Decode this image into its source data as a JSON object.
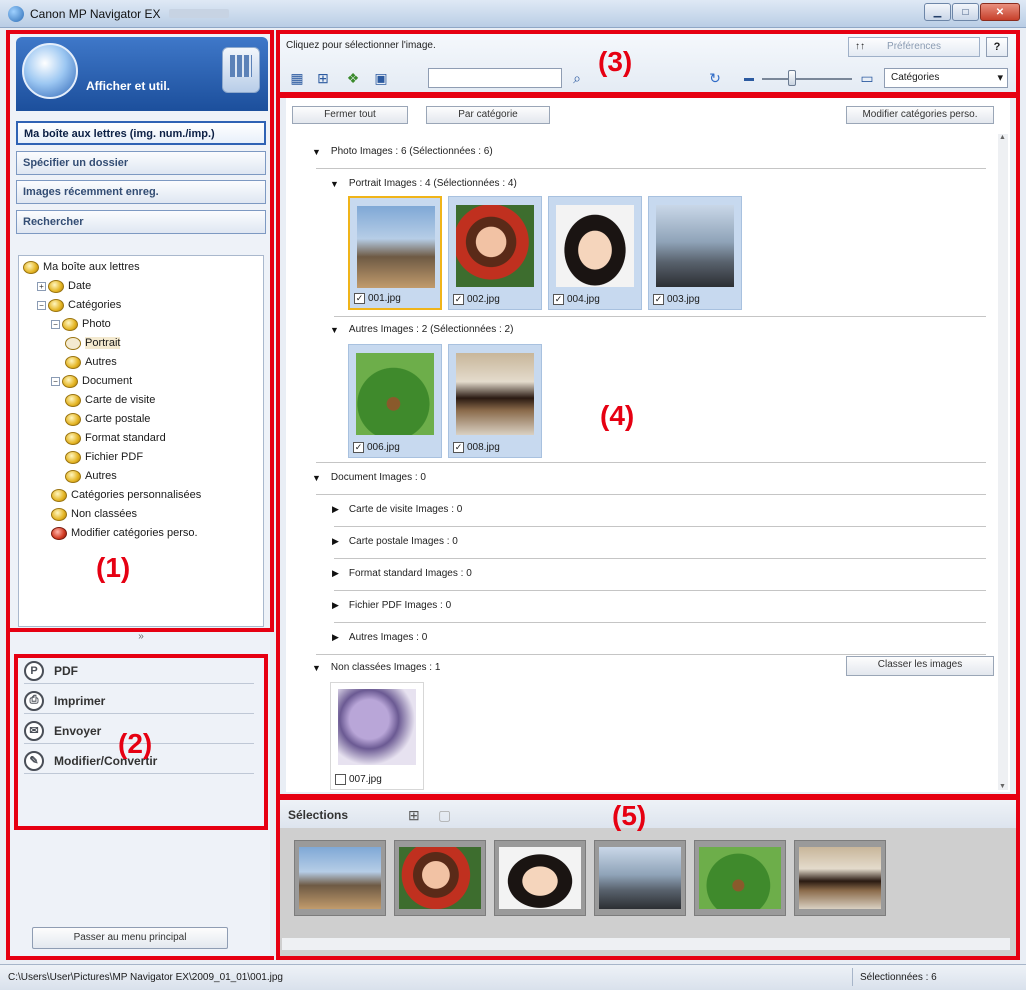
{
  "window": {
    "title": "Canon MP Navigator EX"
  },
  "left_panel": {
    "mode_label": "Afficher et util.",
    "nav_buttons": [
      {
        "label": "Ma boîte aux lettres (img. num./imp.)",
        "active": true
      },
      {
        "label": "Spécifier un dossier",
        "active": false
      },
      {
        "label": "Images récemment enreg.",
        "active": false
      },
      {
        "label": "Rechercher",
        "active": false
      }
    ],
    "tree": [
      {
        "label": "Ma boîte aux lettres",
        "level": 0,
        "toggle": "",
        "color": "yellow"
      },
      {
        "label": "Date",
        "level": 1,
        "toggle": "+",
        "color": "yellow"
      },
      {
        "label": "Catégories",
        "level": 1,
        "toggle": "−",
        "color": "yellow"
      },
      {
        "label": "Photo",
        "level": 2,
        "toggle": "−",
        "color": "yellow"
      },
      {
        "label": "Portrait",
        "level": 3,
        "toggle": "",
        "color": "yellow",
        "selected": true
      },
      {
        "label": "Autres",
        "level": 3,
        "toggle": "",
        "color": "yellow"
      },
      {
        "label": "Document",
        "level": 2,
        "toggle": "−",
        "color": "yellow"
      },
      {
        "label": "Carte de visite",
        "level": 3,
        "toggle": "",
        "color": "yellow"
      },
      {
        "label": "Carte postale",
        "level": 3,
        "toggle": "",
        "color": "yellow"
      },
      {
        "label": "Format standard",
        "level": 3,
        "toggle": "",
        "color": "yellow"
      },
      {
        "label": "Fichier PDF",
        "level": 3,
        "toggle": "",
        "color": "yellow"
      },
      {
        "label": "Autres",
        "level": 3,
        "toggle": "",
        "color": "yellow"
      },
      {
        "label": "Catégories personnalisées",
        "level": 2,
        "toggle": "",
        "color": "yellow"
      },
      {
        "label": "Non classées",
        "level": 2,
        "toggle": "",
        "color": "yellow"
      },
      {
        "label": "Modifier catégories perso.",
        "level": 2,
        "toggle": "",
        "color": "red"
      }
    ],
    "collapse_glyph": "»",
    "tasks": [
      {
        "label": "PDF",
        "icon": "pdf-icon",
        "glyph": "P"
      },
      {
        "label": "Imprimer",
        "icon": "printer-icon",
        "glyph": "⎙"
      },
      {
        "label": "Envoyer",
        "icon": "mail-icon",
        "glyph": "✉"
      },
      {
        "label": "Modifier/Convertir",
        "icon": "pencil-icon",
        "glyph": "✎"
      }
    ],
    "main_menu_label": "Passer au menu principal"
  },
  "toolbar": {
    "hint": "Cliquez pour sélectionner l'image.",
    "preferences_label": "Préférences",
    "help_label": "?",
    "search_value": "",
    "category_value": "Catégories"
  },
  "content": {
    "close_all_label": "Fermer tout",
    "by_category_label": "Par catégorie",
    "edit_categories_label": "Modifier catégories perso.",
    "classify_label": "Classer les images",
    "sections": [
      {
        "label": "Photo    Images : 6    (Sélectionnées : 6)",
        "expanded": true
      },
      {
        "label": "Portrait    Images : 4    (Sélectionnées : 4)",
        "expanded": true
      },
      {
        "label": "Autres    Images : 2    (Sélectionnées : 2)",
        "expanded": true
      },
      {
        "label": "Document    Images : 0",
        "expanded": true
      },
      {
        "label": "Carte de visite    Images : 0",
        "expanded": false
      },
      {
        "label": "Carte postale    Images : 0",
        "expanded": false
      },
      {
        "label": "Format standard    Images : 0",
        "expanded": false
      },
      {
        "label": "Fichier PDF    Images : 0",
        "expanded": false
      },
      {
        "label": "Autres    Images : 0",
        "expanded": false
      },
      {
        "label": "Non classées    Images : 1",
        "expanded": true
      }
    ],
    "portrait_images": [
      {
        "name": "001.jpg",
        "checked": true
      },
      {
        "name": "002.jpg",
        "checked": true
      },
      {
        "name": "004.jpg",
        "checked": true
      },
      {
        "name": "003.jpg",
        "checked": true
      }
    ],
    "autres_images": [
      {
        "name": "006.jpg",
        "checked": true
      },
      {
        "name": "008.jpg",
        "checked": true
      }
    ],
    "unclassified_images": [
      {
        "name": "007.jpg",
        "checked": false
      }
    ]
  },
  "tray": {
    "title": "Sélections",
    "count": 6
  },
  "status": {
    "path": "C:\\Users\\User\\Pictures\\MP Navigator EX\\2009_01_01\\001.jpg",
    "selected": "Sélectionnées : 6"
  },
  "callouts": [
    "(1)",
    "(2)",
    "(3)",
    "(4)",
    "(5)"
  ],
  "accent_color": "#e60012"
}
